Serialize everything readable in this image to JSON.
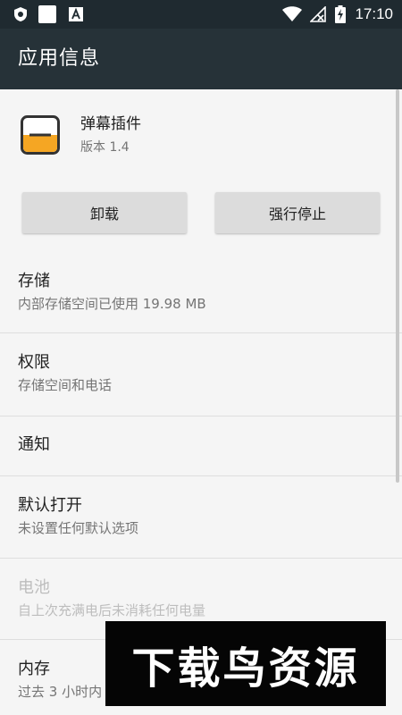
{
  "status_bar": {
    "time": "17:10",
    "icons": [
      "shield-icon",
      "notification-square-icon",
      "font-a-icon",
      "wifi-icon",
      "no-signal-icon",
      "battery-charging-icon"
    ]
  },
  "app_bar": {
    "title": "应用信息"
  },
  "app": {
    "name": "弹幕插件",
    "version": "版本 1.4",
    "icon_accent": "#f5a623"
  },
  "buttons": {
    "uninstall": "卸载",
    "force_stop": "强行停止"
  },
  "items": [
    {
      "label": "存储",
      "sub": "内部存储空间已使用 19.98 MB"
    },
    {
      "label": "权限",
      "sub": "存储空间和电话"
    },
    {
      "label": "通知",
      "sub": ""
    },
    {
      "label": "默认打开",
      "sub": "未设置任何默认选项"
    },
    {
      "label": "电池",
      "sub": "自上次充满电后未消耗任何电量"
    },
    {
      "label": "内存",
      "sub": "过去 3 小时内"
    }
  ],
  "watermark": {
    "text": "下载鸟资源"
  }
}
